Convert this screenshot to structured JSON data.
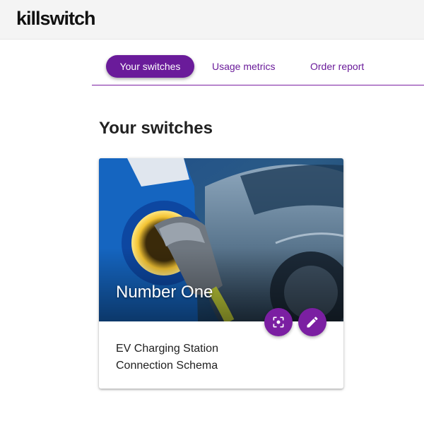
{
  "app": {
    "logo": "killswitch"
  },
  "tabs": [
    {
      "label": "Your switches",
      "active": true
    },
    {
      "label": "Usage metrics",
      "active": false
    },
    {
      "label": "Order report",
      "active": false
    }
  ],
  "page": {
    "title": "Your switches"
  },
  "cards": [
    {
      "title": "Number One",
      "description_line1": "EV Charging Station",
      "description_line2": "Connection Schema",
      "image_icon": "ev-charging-photo",
      "actions": [
        {
          "icon": "center-focus-icon"
        },
        {
          "icon": "edit-pencil-icon"
        }
      ]
    }
  ],
  "colors": {
    "accent": "#6a1b9a",
    "fab": "#7b1fa2",
    "topbar": "#f4f4f4"
  }
}
